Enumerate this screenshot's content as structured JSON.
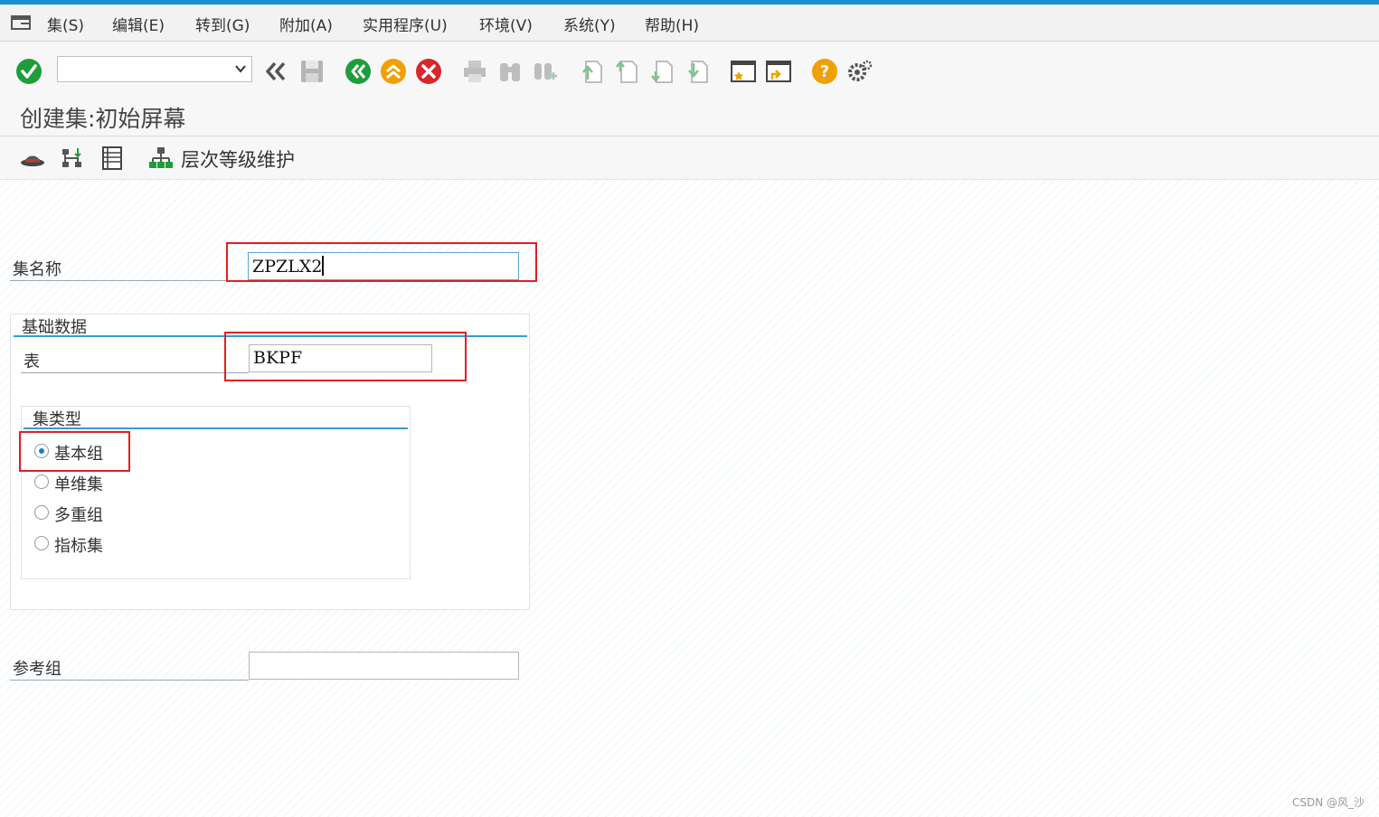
{
  "menu": {
    "items": [
      "集(S)",
      "编辑(E)",
      "转到(G)",
      "附加(A)",
      "实用程序(U)",
      "环境(V)",
      "系统(Y)",
      "帮助(H)"
    ]
  },
  "toolbar": {
    "command_value": "",
    "icons": [
      "enter-icon",
      "back-arrows-icon",
      "save-icon",
      "back-icon",
      "exit-icon",
      "cancel-icon",
      "print-icon",
      "find-icon",
      "find-next-icon",
      "first-page-icon",
      "previous-page-icon",
      "next-page-icon",
      "last-page-icon",
      "create-session-icon",
      "shortcut-icon",
      "help-icon",
      "settings-icon"
    ]
  },
  "title": "创建集:初始屏幕",
  "app_toolbar": {
    "hierarchy_label": "层次等级维护"
  },
  "form": {
    "set_name_label": "集名称",
    "set_name_value": "ZPZLX2",
    "basic_data_title": "基础数据",
    "table_label": "表",
    "table_value": "BKPF",
    "set_type_title": "集类型",
    "set_types": [
      {
        "label": "基本组",
        "selected": true
      },
      {
        "label": "单维集",
        "selected": false
      },
      {
        "label": "多重组",
        "selected": false
      },
      {
        "label": "指标集",
        "selected": false
      }
    ],
    "ref_group_label": "参考组",
    "ref_group_value": ""
  },
  "watermark": "CSDN @风_沙",
  "colors": {
    "accent": "#1a8fd1",
    "highlight": "#e02020",
    "green": "#1e9e3a",
    "orange": "#f0a000",
    "red": "#d9262b"
  }
}
